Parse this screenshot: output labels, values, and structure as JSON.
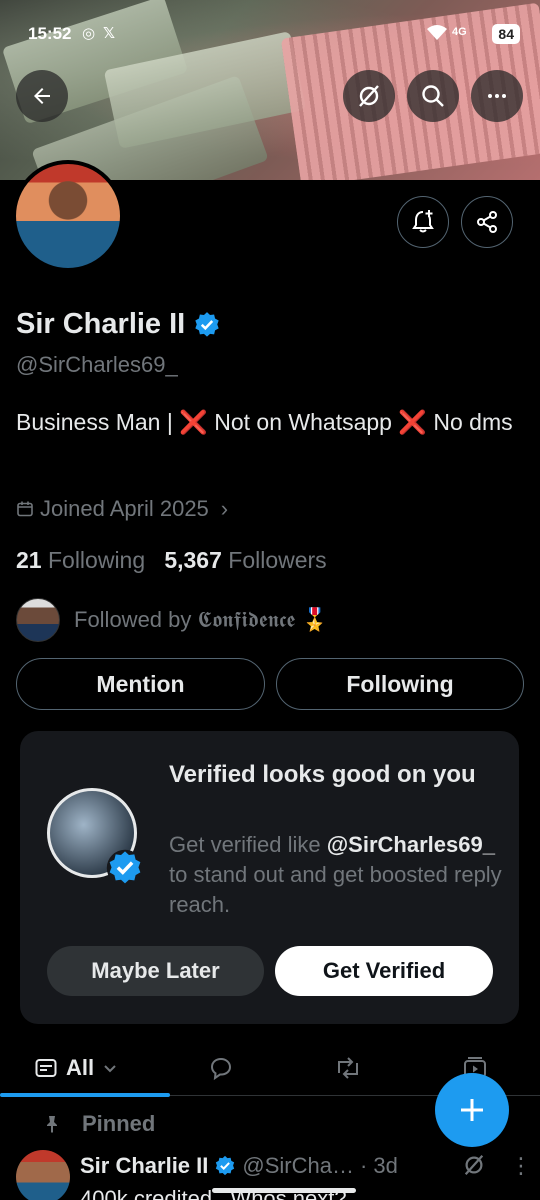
{
  "status_bar": {
    "time": "15:52",
    "network": "4G",
    "battery": "84"
  },
  "header": {
    "back_icon": "arrow-left-icon",
    "grok_icon": "grok-icon",
    "search_icon": "search-icon",
    "more_icon": "more-horizontal-icon"
  },
  "profile": {
    "name": "Sir Charlie II",
    "handle": "@SirCharles69_",
    "bio_part1": "Business Man | ",
    "bio_x1": "❌",
    "bio_part2": " Not on Whatsapp ",
    "bio_x2": "❌",
    "bio_part3": " No dms",
    "joined": "Joined April 2025",
    "following_count": "21",
    "following_label": "Following",
    "followers_count": "5,367",
    "followers_label": "Followers",
    "followed_by": "Followed by 𝕮𝖔𝖓𝖋𝖎𝖉𝖊𝖓𝖈𝖊 🎖️",
    "mention_label": "Mention",
    "following_button_label": "Following"
  },
  "verify_card": {
    "title": "Verified looks good on you",
    "desc_prefix": "Get verified like ",
    "desc_handle": "@SirCharles69_",
    "desc_suffix": " to stand out and get boosted reply reach.",
    "maybe_later": "Maybe Later",
    "get_verified": "Get Verified"
  },
  "tabs": {
    "active_label": "All",
    "items": [
      "all-tab",
      "replies-tab",
      "reposts-tab",
      "media-tab"
    ]
  },
  "pinned": {
    "label": "Pinned",
    "name": "Sir Charlie II",
    "handle": "@SirCha…",
    "time": "· 3d",
    "text": "400k credited.. Whos next?"
  },
  "colors": {
    "accent": "#1d9bf0",
    "background": "#000000",
    "muted": "#71767b"
  }
}
